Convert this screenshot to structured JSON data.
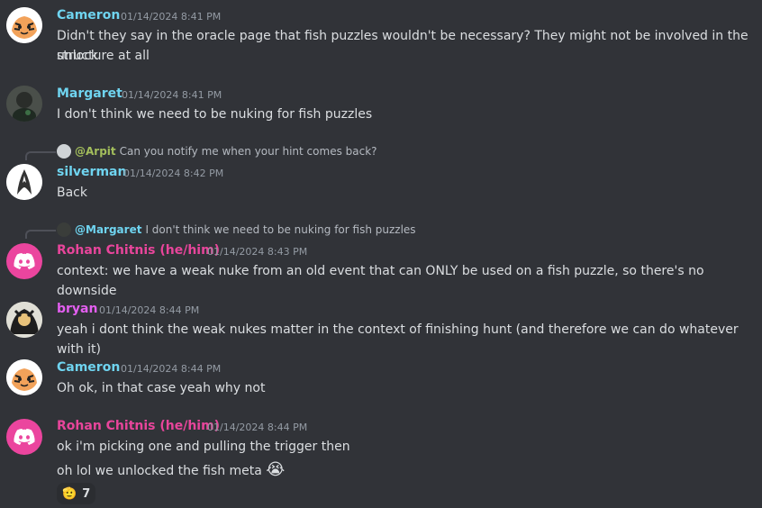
{
  "messages": [
    {
      "author": "Cameron",
      "time": "01/14/2024 8:41 PM",
      "color": "#6fd4f0",
      "lines": [
        "Didn't they say in the oracle page that fish puzzles wouldn't be necessary? They might not be involved in the unlock",
        "structure at all"
      ]
    },
    {
      "author": "Margaret",
      "time": "01/14/2024 8:41 PM",
      "color": "#6fd4f0",
      "lines": [
        "I don't think we need to be nuking for fish puzzles"
      ]
    },
    {
      "author": "silverman",
      "time": "01/14/2024 8:42 PM",
      "color": "#6fd4f0",
      "reply": {
        "mention": "@Arpit",
        "text": "Can you notify me when your hint comes back?",
        "mention_color": "#a3be5c"
      },
      "lines": [
        "Back"
      ]
    },
    {
      "author": "Rohan Chitnis (he/him)",
      "time": "01/14/2024 8:43 PM",
      "color": "#e8459b",
      "reply": {
        "mention": "@Margaret",
        "text": "I don't think we need to be nuking for fish puzzles",
        "mention_color": "#6fd4f0"
      },
      "lines": [
        "context: we have a weak nuke from an old event that can ONLY be used on a fish puzzle, so there's no downside"
      ]
    },
    {
      "author": "bryan",
      "time": "01/14/2024 8:44 PM",
      "color": "#e35ff0",
      "lines": [
        "yeah i dont think the weak nukes matter in the context of finishing hunt (and therefore we can do whatever with it)"
      ]
    },
    {
      "author": "Cameron",
      "time": "01/14/2024 8:44 PM",
      "color": "#6fd4f0",
      "lines": [
        "Oh ok, in that case yeah why not"
      ]
    },
    {
      "author": "Rohan Chitnis (he/him)",
      "time": "01/14/2024 8:44 PM",
      "color": "#e8459b",
      "lines": [
        "ok i'm picking one and pulling the trigger then",
        "oh lol we unlocked the fish meta"
      ],
      "emoji": "😭",
      "reaction": {
        "emoji": "🫡",
        "count": "7"
      }
    }
  ]
}
